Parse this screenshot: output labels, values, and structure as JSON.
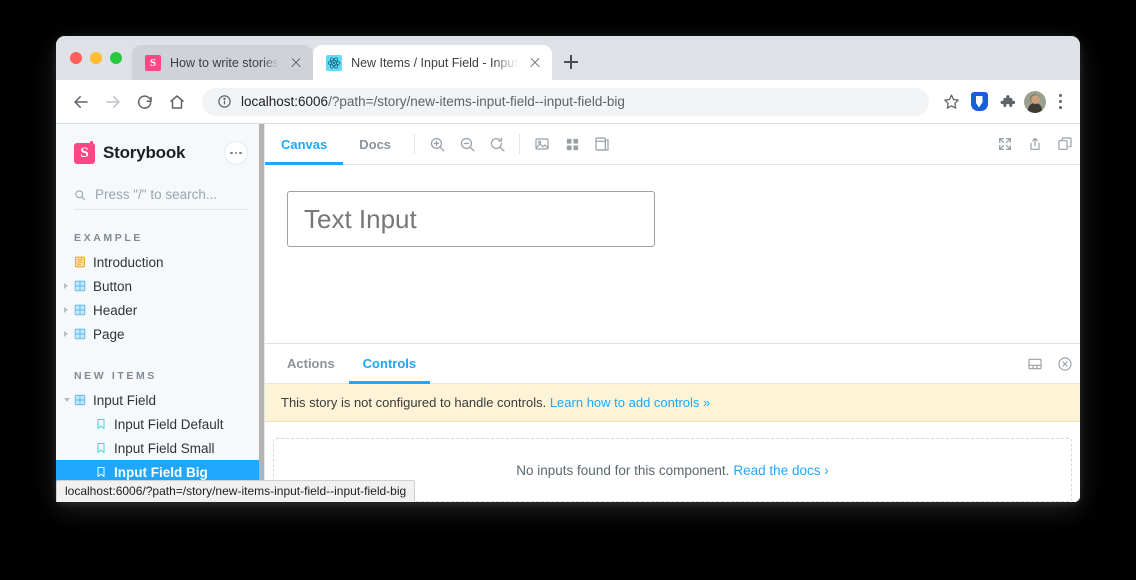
{
  "browser": {
    "tabs": [
      {
        "title": "How to write stories",
        "favicon": "storybook-favicon",
        "active": false
      },
      {
        "title": "New Items / Input Field - Input",
        "favicon": "react-favicon",
        "active": true
      }
    ],
    "new_tab_label": "+",
    "omnibox": {
      "host": "localhost:6006",
      "path": "/?path=/story/new-items-input-field--input-field-big"
    },
    "toolbar_icons": [
      "back-icon",
      "forward-icon",
      "reload-icon",
      "home-icon",
      "info-icon",
      "bookmark-star-icon",
      "bitwarden-shield-icon",
      "extensions-puzzle-icon",
      "profile-avatar",
      "chrome-menu-icon"
    ]
  },
  "sidebar": {
    "brand": "Storybook",
    "menu_icon": "ellipsis-icon",
    "search": {
      "placeholder": "Press \"/\" to search...",
      "value": "",
      "icon": "search-icon"
    },
    "sections": [
      {
        "title": "EXAMPLE",
        "items": [
          {
            "label": "Introduction",
            "icon": "document-icon",
            "expandable": false,
            "depth": 0,
            "selected": false
          },
          {
            "label": "Button",
            "icon": "component-icon",
            "expandable": true,
            "expanded": false,
            "depth": 0,
            "selected": false
          },
          {
            "label": "Header",
            "icon": "component-icon",
            "expandable": true,
            "expanded": false,
            "depth": 0,
            "selected": false
          },
          {
            "label": "Page",
            "icon": "component-icon",
            "expandable": true,
            "expanded": false,
            "depth": 0,
            "selected": false
          }
        ]
      },
      {
        "title": "NEW ITEMS",
        "items": [
          {
            "label": "Input Field",
            "icon": "component-icon",
            "expandable": true,
            "expanded": true,
            "depth": 0,
            "selected": false
          },
          {
            "label": "Input Field Default",
            "icon": "story-bookmark-icon",
            "expandable": false,
            "depth": 1,
            "selected": false
          },
          {
            "label": "Input Field Small",
            "icon": "story-bookmark-icon",
            "expandable": false,
            "depth": 1,
            "selected": false
          },
          {
            "label": "Input Field Big",
            "icon": "story-bookmark-icon",
            "expandable": false,
            "depth": 1,
            "selected": true
          }
        ]
      }
    ]
  },
  "preview_toolbar": {
    "tabs": [
      {
        "label": "Canvas",
        "active": true
      },
      {
        "label": "Docs",
        "active": false
      }
    ],
    "left_icons": [
      "zoom-in-icon",
      "zoom-out-icon",
      "zoom-reset-icon",
      "backgrounds-icon",
      "grid-icon",
      "measure-icon"
    ],
    "right_icons": [
      "fullscreen-icon",
      "share-icon",
      "open-new-tab-icon"
    ]
  },
  "canvas": {
    "input": {
      "placeholder": "Text Input",
      "value": ""
    }
  },
  "addon_panel": {
    "tabs": [
      {
        "label": "Actions",
        "active": false
      },
      {
        "label": "Controls",
        "active": true
      }
    ],
    "right_icons": [
      "panel-position-icon",
      "close-panel-icon"
    ],
    "notice": {
      "text": "This story is not configured to handle controls.",
      "link": "Learn how to add controls »"
    },
    "empty": {
      "text": "No inputs found for this component.",
      "link": "Read the docs ›"
    }
  },
  "status_bar": {
    "text": "localhost:6006/?path=/story/new-items-input-field--input-field-big"
  },
  "colors": {
    "accent": "#1ea7fd",
    "brand_pink": "#ff4785",
    "notice_bg": "#fdf4d8",
    "sidebar_bg": "#f6f9fc"
  }
}
